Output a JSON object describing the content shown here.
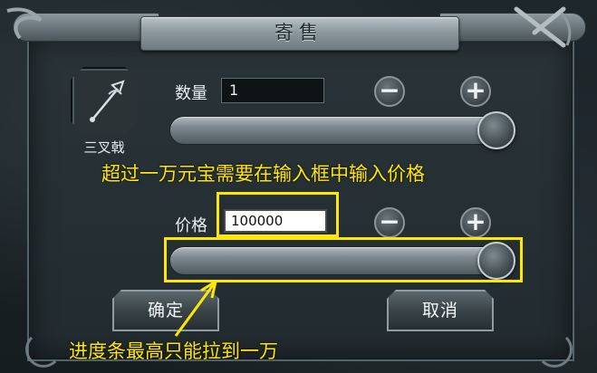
{
  "window": {
    "title": "寄售"
  },
  "item": {
    "name": "三叉戟",
    "icon": "trident-icon"
  },
  "quantity": {
    "label": "数量",
    "value": "1",
    "minus_icon": "minus-icon",
    "plus_icon": "plus-icon",
    "slider_fill": 1.0
  },
  "price": {
    "label": "价格",
    "value": "100000",
    "minus_icon": "minus-icon",
    "plus_icon": "plus-icon",
    "slider_fill": 1.0
  },
  "buttons": {
    "confirm": "确定",
    "cancel": "取消"
  },
  "annotations": {
    "price_note": "超过一万元宝需要在输入框中输入价格",
    "slider_note": "进度条最高只能拉到一万",
    "color": "#ffe800"
  }
}
